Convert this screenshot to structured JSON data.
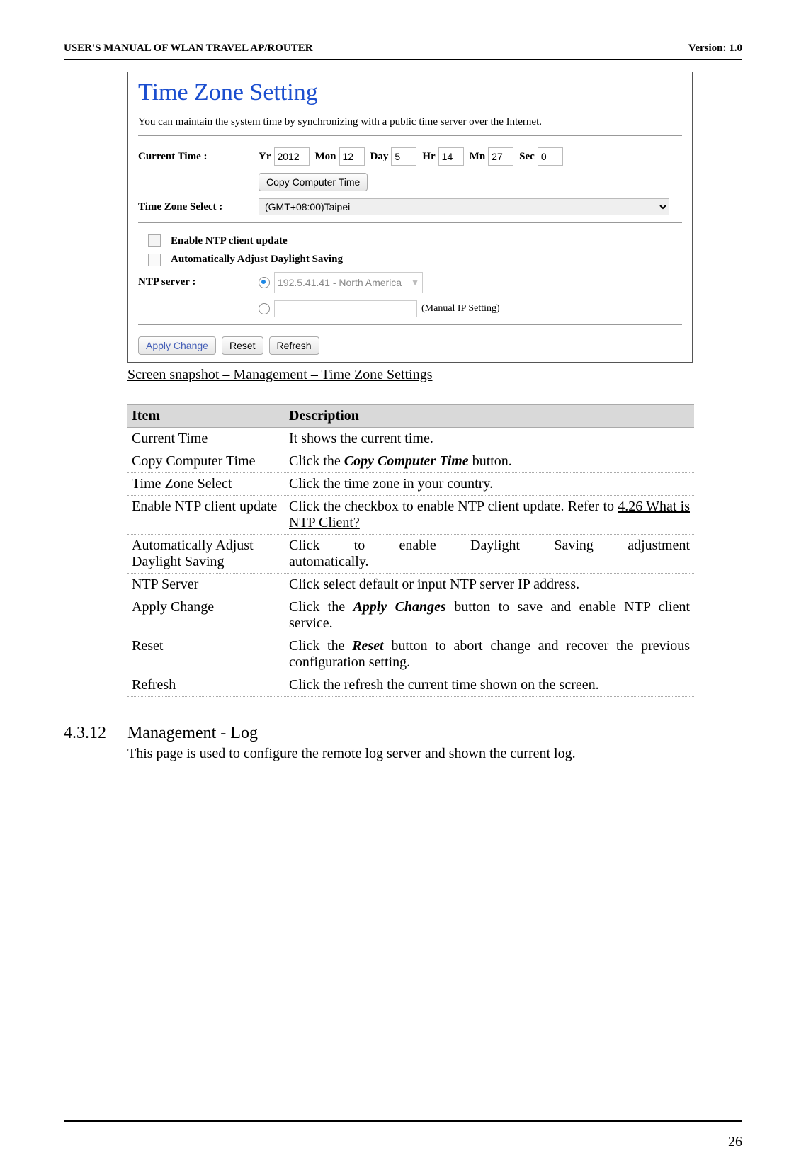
{
  "header": {
    "left": "USER'S MANUAL OF WLAN TRAVEL AP/ROUTER",
    "right": "Version: 1.0"
  },
  "screenshot": {
    "title": "Time Zone Setting",
    "description": "You can maintain the system time by synchronizing with a public time server over the Internet.",
    "currentTimeLabel": "Current Time :",
    "yrLabel": "Yr",
    "yr": "2012",
    "monLabel": "Mon",
    "mon": "12",
    "dayLabel": "Day",
    "day": "5",
    "hrLabel": "Hr",
    "hr": "14",
    "mnLabel": "Mn",
    "mn": "27",
    "secLabel": "Sec",
    "sec": "0",
    "copyBtn": "Copy Computer Time",
    "tzLabel": "Time Zone Select :",
    "tzValue": "(GMT+08:00)Taipei",
    "enableNtp": "Enable NTP client update",
    "adjustDst": "Automatically Adjust Daylight Saving",
    "ntpLabel": "NTP server :",
    "ntpPreset": "192.5.41.41 - North America",
    "manual": "(Manual IP Setting)",
    "applyBtn": "Apply Change",
    "resetBtn": "Reset",
    "refreshBtn": "Refresh"
  },
  "caption": "Screen snapshot – Management – Time Zone Settings",
  "table": {
    "headers": {
      "item": "Item",
      "desc": "Description"
    },
    "rows": [
      {
        "item": "Current Time",
        "desc": "It shows the current time."
      },
      {
        "item": "Copy Computer Time",
        "desc_pre": "Click the ",
        "bi": "Copy Computer Time",
        "desc_post": " button."
      },
      {
        "item": "Time Zone Select",
        "desc": "Click the time zone in your country."
      },
      {
        "item": "Enable NTP client update",
        "desc_pre": "Click the checkbox to enable NTP client update. Refer to ",
        "u": "4.26 What is NTP Client?"
      },
      {
        "item": "Automatically Adjust Daylight Saving",
        "desc_spread": "Click to enable Daylight Saving adjustment",
        "desc_line2": "automatically."
      },
      {
        "item": "NTP Server",
        "desc": "Click select default or input NTP server IP address."
      },
      {
        "item": "Apply Change",
        "desc_pre": "Click the ",
        "bi": "Apply Changes",
        "desc_post": " button to save and enable NTP client service."
      },
      {
        "item": "Reset",
        "desc_pre": "Click the ",
        "bi": "Reset",
        "desc_post": " button to abort change and recover the previous configuration setting."
      },
      {
        "item": "Refresh",
        "desc": "Click the refresh the current time shown on the screen."
      }
    ]
  },
  "section": {
    "num": "4.3.12",
    "title": "Management - Log",
    "body": "This page is used to configure the remote log server and shown the current log."
  },
  "pageNumber": "26"
}
